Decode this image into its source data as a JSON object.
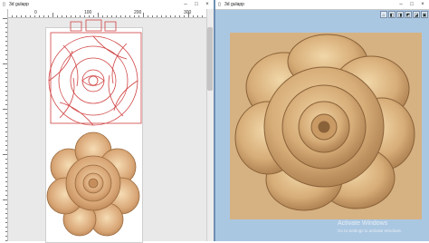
{
  "left_window": {
    "title": "3d gulapp",
    "ruler_numbers": [
      "0",
      "100",
      "200",
      "300"
    ],
    "controls": {
      "minimize": "–",
      "maximize": "□",
      "close": "×"
    }
  },
  "right_window": {
    "title": "3d gulapp",
    "controls": {
      "minimize": "–",
      "maximize": "□",
      "close": "×"
    },
    "view_buttons": [
      "⌂",
      "◧",
      "◨",
      "◩",
      "◪",
      "▣"
    ]
  },
  "watermark": {
    "title": "Activate Windows",
    "subtitle": "Go to Settings to activate Windows."
  },
  "icons": {
    "title_icon": "document-icon"
  },
  "colors": {
    "wood": "#d6b282",
    "vector_red": "#d04040",
    "workspace_blue": "#aac7e2"
  }
}
